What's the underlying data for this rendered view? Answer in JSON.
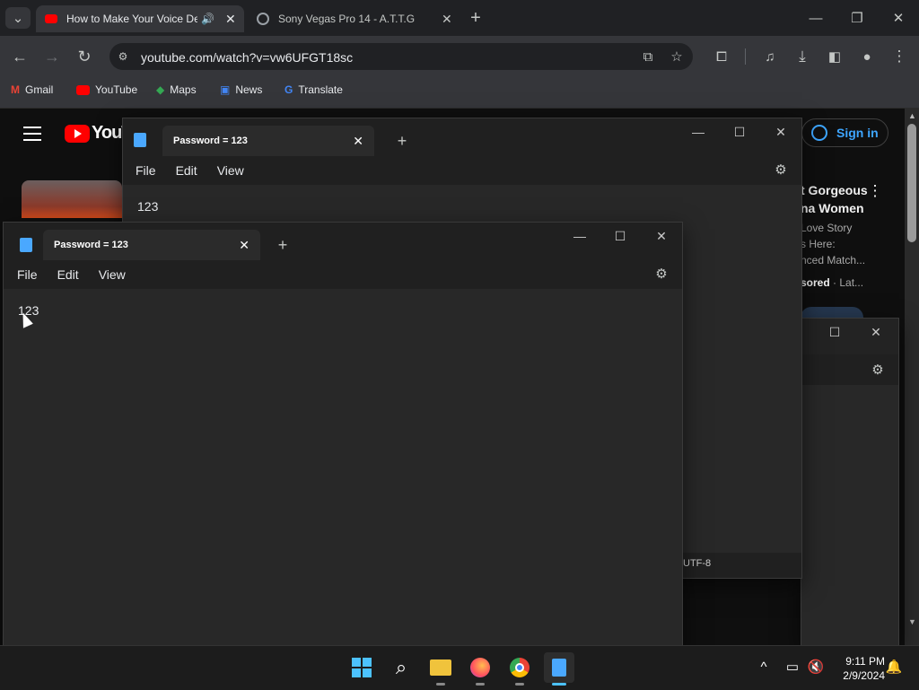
{
  "browser": {
    "tabs": [
      {
        "title": "How to Make Your Voice De",
        "active": true
      },
      {
        "title": "Sony Vegas Pro 14 - A.T.T.G",
        "active": false
      }
    ],
    "url": "youtube.com/watch?v=vw6UFGT18sc",
    "bookmarks": [
      {
        "label": "Gmail"
      },
      {
        "label": "YouTube"
      },
      {
        "label": "Maps"
      },
      {
        "label": "News"
      },
      {
        "label": "Translate"
      }
    ]
  },
  "youtube": {
    "logo": "YouTube",
    "sign_in": "Sign in",
    "ad_title_1": "t Gorgeous",
    "ad_title_2": "na Women",
    "ad_line_1": "Love Story",
    "ad_line_2": "s Here:",
    "ad_line_3": "nced Match...",
    "ad_sponsored": "sored",
    "ad_sep": " · Lat..."
  },
  "notepad_back": {
    "tab_title": "Password = 123",
    "menu": [
      "File",
      "Edit",
      "View"
    ],
    "content": "123",
    "encoding": "UTF-8"
  },
  "notepad_front": {
    "tab_title": "Password = 123",
    "menu": [
      "File",
      "Edit",
      "View"
    ],
    "content": "123"
  },
  "taskbar": {
    "time": "9:11 PM",
    "date": "2/9/2024"
  },
  "colors": {
    "accent_blue": "#3ea6ff",
    "youtube_red": "#ff0000",
    "notepad_blue": "#4aa8ff"
  }
}
